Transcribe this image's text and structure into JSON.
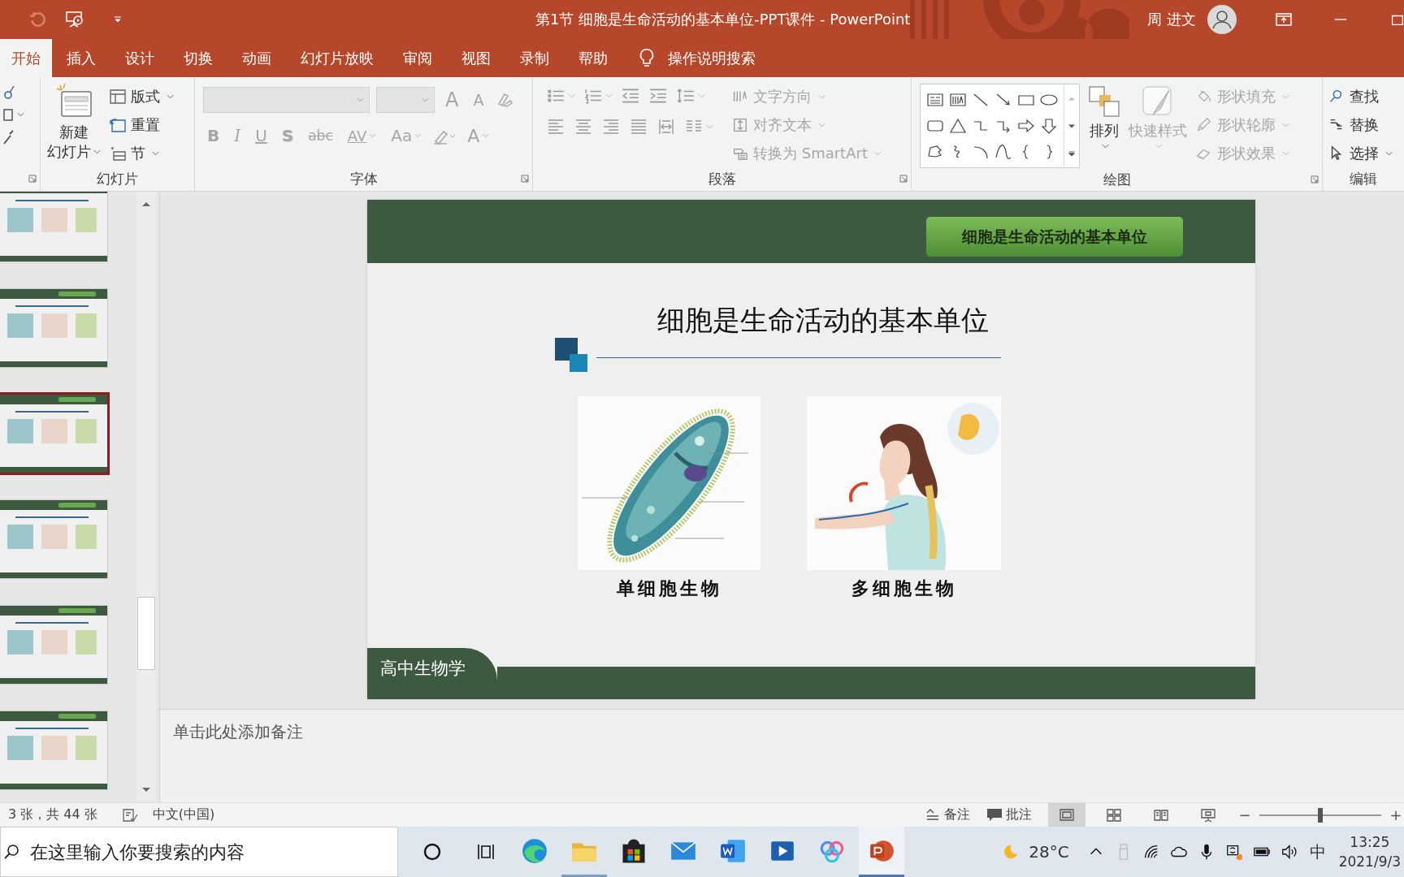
{
  "title_bar": {
    "title": "第1节 细胞是生命活动的基本单位-PPT课件  -  PowerPoint",
    "user": "周 进文"
  },
  "tabs": [
    {
      "label": "开始",
      "selected": true
    },
    {
      "label": "插入",
      "selected": false
    },
    {
      "label": "设计",
      "selected": false
    },
    {
      "label": "切换",
      "selected": false
    },
    {
      "label": "动画",
      "selected": false
    },
    {
      "label": "幻灯片放映",
      "selected": false
    },
    {
      "label": "审阅",
      "selected": false
    },
    {
      "label": "视图",
      "selected": false
    },
    {
      "label": "录制",
      "selected": false
    },
    {
      "label": "帮助",
      "selected": false
    }
  ],
  "tell_me": "操作说明搜索",
  "ribbon": {
    "slides": {
      "label": "幻灯片",
      "new_slide": [
        "新建",
        "幻灯片"
      ],
      "items": [
        {
          "label": "版式",
          "disabled": false
        },
        {
          "label": "重置",
          "disabled": false
        },
        {
          "label": "节",
          "disabled": false
        }
      ]
    },
    "font": {
      "label": "字体",
      "size_buttons": [
        {
          "label": "A",
          "disabled": true
        },
        {
          "label": "A",
          "disabled": true
        }
      ],
      "format_buttons": [
        {
          "label": "B",
          "disabled": true
        },
        {
          "label": "I",
          "disabled": true
        },
        {
          "label": "U",
          "disabled": true
        },
        {
          "label": "S",
          "disabled": true
        },
        {
          "label": "abc",
          "disabled": true
        },
        {
          "label": "AV",
          "disabled": true
        },
        {
          "label": "Aa",
          "disabled": true
        },
        {
          "label": "A",
          "disabled": true
        }
      ]
    },
    "paragraph": {
      "label": "段落",
      "items": [
        {
          "label": "文字方向",
          "disabled": true
        },
        {
          "label": "对齐文本",
          "disabled": true
        },
        {
          "label": "转换为 SmartArt",
          "disabled": true
        }
      ]
    },
    "drawing": {
      "label": "绘图",
      "arrange": {
        "label": "排列",
        "disabled": false
      },
      "quick_styles": {
        "label": "快速样式",
        "disabled": true
      },
      "items": [
        {
          "label": "形状填充",
          "disabled": true
        },
        {
          "label": "形状轮廓",
          "disabled": true
        },
        {
          "label": "形状效果",
          "disabled": true
        }
      ]
    },
    "editing": {
      "label": "编辑",
      "items": [
        {
          "label": "查找",
          "disabled": false
        },
        {
          "label": "替换",
          "disabled": false
        },
        {
          "label": "选择",
          "disabled": false
        }
      ]
    }
  },
  "thumbnails": [
    {
      "selected": false
    },
    {
      "selected": false
    },
    {
      "selected": true
    },
    {
      "selected": false
    },
    {
      "selected": false
    },
    {
      "selected": false
    }
  ],
  "slide": {
    "badge": "细胞是生命活动的基本单位",
    "title": "细胞是生命活动的基本单位",
    "figures": [
      {
        "caption": "单细胞生物"
      },
      {
        "caption": "多细胞生物"
      }
    ],
    "footer": "高中生物学"
  },
  "notes": {
    "placeholder": "单击此处添加备注"
  },
  "status_bar": {
    "slide_count": "3 张，共 44 张",
    "language": "中文(中国)",
    "notes": "备注",
    "comments": "批注",
    "views": [
      {
        "selected": true
      },
      {
        "selected": false
      },
      {
        "selected": false
      },
      {
        "selected": false
      }
    ],
    "zoom": {
      "minus": "−",
      "plus": "+",
      "level": 0.5
    }
  },
  "taskbar": {
    "search": {
      "placeholder": "在这里输入你要搜索的内容"
    },
    "apps": [
      {
        "running": false,
        "active": false
      },
      {
        "running": true,
        "active": false
      },
      {
        "running": false,
        "active": false
      },
      {
        "running": false,
        "active": false
      },
      {
        "running": false,
        "active": false
      },
      {
        "running": false,
        "active": false
      },
      {
        "running": false,
        "active": false
      },
      {
        "running": true,
        "active": true
      }
    ],
    "temperature": "28°C",
    "ime": "中",
    "time": "13:25",
    "date": "2021/9/3"
  }
}
